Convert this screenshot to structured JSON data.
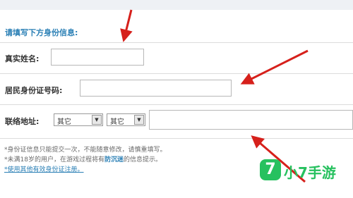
{
  "form": {
    "section_title": "请填写下方身份信息:",
    "name_label": "真实姓名:",
    "name_value": "",
    "id_label": "居民身份证号码:",
    "id_value": "",
    "address_label": "联络地址:",
    "province_select": "其它",
    "city_select": "其它",
    "address_value": ""
  },
  "notes": {
    "line1": "*身份证信息只能提交一次，不能随意修改，请慎重填写。",
    "line2_pre": "*未满18岁的用户，在游戏过程将有",
    "line2_em": "防沉迷",
    "line2_post": "的信息提示。",
    "line3": "*使用其他有效身份证注册。"
  },
  "watermark": {
    "badge": "7",
    "text": "小7手游"
  },
  "colors": {
    "accent": "#2a7fb5",
    "arrow": "#d6201b",
    "watermark": "#27c15f"
  }
}
